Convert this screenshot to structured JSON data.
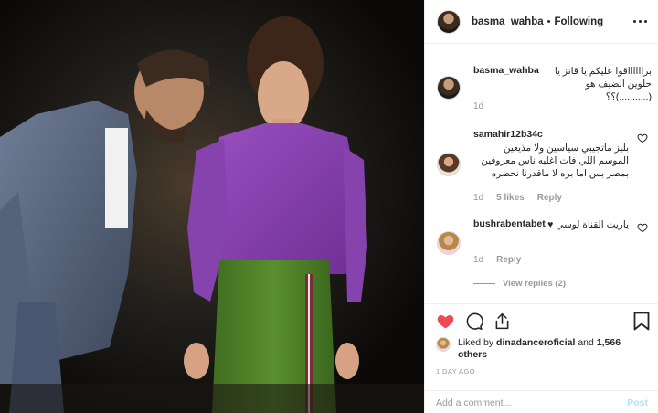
{
  "header": {
    "username": "basma_wahba",
    "separator": "•",
    "follow_status": "Following"
  },
  "comments": [
    {
      "username": "basma_wahba",
      "text": "برااااااقوا عليكم يا قانز يا حلوين الضيف هو (...........)؟؟",
      "time": "1d"
    },
    {
      "username": "samahir12b34c",
      "text": "بليز ماتجيبي سياسين ولا مذيعين الموسم اللي فات اغلبه ناس معروفين بمصر بس اما بره لا ماقدرنا نحضره",
      "time": "1d",
      "likes": "5 likes",
      "reply": "Reply"
    },
    {
      "username": "bushrabentabet",
      "text": "ياريت القناة لوسي ♥",
      "time": "1d",
      "reply": "Reply",
      "view_replies": "View replies (2)"
    }
  ],
  "likes": {
    "prefix": "Liked by",
    "user": "dinadanceroficial",
    "and": "and",
    "others": "1,566 others"
  },
  "timestamp": "1 DAY AGO",
  "add_comment": {
    "placeholder": "Add a comment...",
    "post_label": "Post"
  },
  "colors": {
    "like_red": "#ed4956",
    "post_disabled": "#b2dffc",
    "muted": "#999999"
  }
}
